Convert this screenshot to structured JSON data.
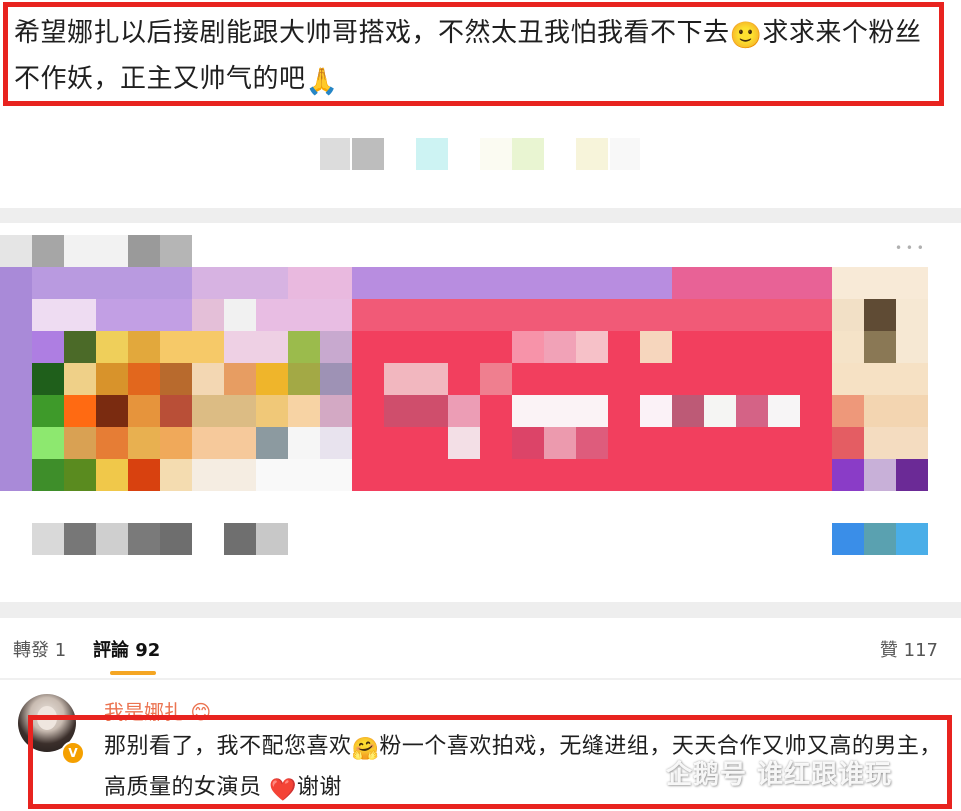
{
  "post": {
    "text_before_emoji": "希望娜扎以后接剧能跟大帅哥搭戏，不然太丑我怕我看不下去",
    "smile_emoji": "🙂",
    "text_after_emoji": "求求来个粉丝不作妖，正主又帅气的吧",
    "pray_emoji": "🙏"
  },
  "tabs": {
    "repost_label": "轉發 1",
    "comment_label": "評論 92",
    "like_label": "贊 117"
  },
  "comment": {
    "author": "我是娜扎",
    "author_emoji": "😊",
    "verified_mark": "V",
    "text_part1": "那别看了，我不配您喜欢",
    "hug_emoji": "🤗",
    "text_part2": "粉一个喜欢拍戏，无缝进组，天天合作又帅又高的男主，高质量的女演员",
    "heart_emoji": "❤️",
    "text_part3": "谢谢"
  },
  "watermark": {
    "text": "企鹅号 谁红跟谁玩"
  },
  "colors": {
    "highlight_border": "#e8231f",
    "author_name": "#eb7350",
    "tab_underline": "#f5a623",
    "verified_badge": "#f5a000"
  }
}
